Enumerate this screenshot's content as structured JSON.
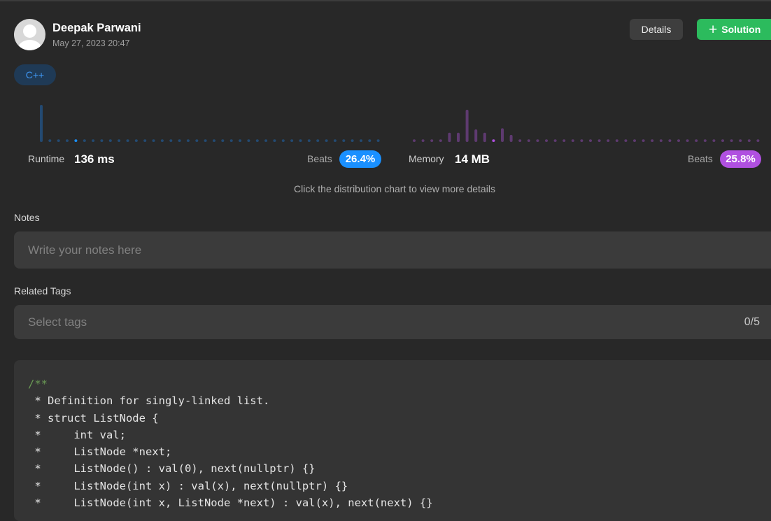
{
  "user": {
    "name": "Deepak Parwani",
    "timestamp": "May 27, 2023 20:47"
  },
  "header": {
    "details_label": "Details",
    "solution_label": "Solution",
    "solution_icon": "plus-icon"
  },
  "language": "C++",
  "runtime": {
    "label": "Runtime",
    "value": "136 ms",
    "beats_label": "Beats",
    "beats": "26.4%"
  },
  "memory": {
    "label": "Memory",
    "value": "14 MB",
    "beats_label": "Beats",
    "beats": "25.8%"
  },
  "chart_hint": "Click the distribution chart to view more details",
  "notes": {
    "label": "Notes",
    "placeholder": "Write your notes here"
  },
  "tags": {
    "label": "Related Tags",
    "placeholder": "Select tags",
    "count": "0/5"
  },
  "code": {
    "first_line": "/**",
    "rest": " * Definition for singly-linked list.\n * struct ListNode {\n *     int val;\n *     ListNode *next;\n *     ListNode() : val(0), next(nullptr) {}\n *     ListNode(int x) : val(x), next(nullptr) {}\n *     ListNode(int x, ListNode *next) : val(x), next(next) {}"
  },
  "colors": {
    "background": "#282828",
    "accent_green": "#2cbb5d",
    "runtime_blue": "#1a90ff",
    "memory_purple": "#b050e0"
  },
  "chart_data": [
    {
      "type": "bar",
      "name": "runtime-distribution",
      "values": [
        10,
        0.7,
        0.7,
        0.7,
        0.7,
        0.7,
        0.7,
        0.7,
        0.7,
        0.7,
        0.7,
        0.7,
        0.7,
        0.7,
        0.7,
        0.7,
        0.7,
        0.7,
        0.7,
        0.7,
        0.7,
        0.7,
        0.7,
        0.7,
        0.7,
        0.7,
        0.7,
        0.7,
        0.7,
        0.7,
        0.7,
        0.7,
        0.7,
        0.7,
        0.7,
        0.7,
        0.7,
        0.7,
        0.7,
        0.7
      ],
      "highlight_index": 4,
      "color": "#1a90ff"
    },
    {
      "type": "bar",
      "name": "memory-distribution",
      "values": [
        0.7,
        0.7,
        0.7,
        0.7,
        2.5,
        2.5,
        8.7,
        3.4,
        2.5,
        0.7,
        3.7,
        1.9,
        0.7,
        0.7,
        0.7,
        0.7,
        0.7,
        0.7,
        0.7,
        0.7,
        0.7,
        0.7,
        0.7,
        0.7,
        0.7,
        0.7,
        0.7,
        0.7,
        0.7,
        0.7,
        0.7,
        0.7,
        0.7,
        0.7,
        0.7,
        0.7,
        0.7,
        0.7,
        0.7,
        0.7
      ],
      "highlight_index": 9,
      "color": "#b050e0"
    }
  ]
}
